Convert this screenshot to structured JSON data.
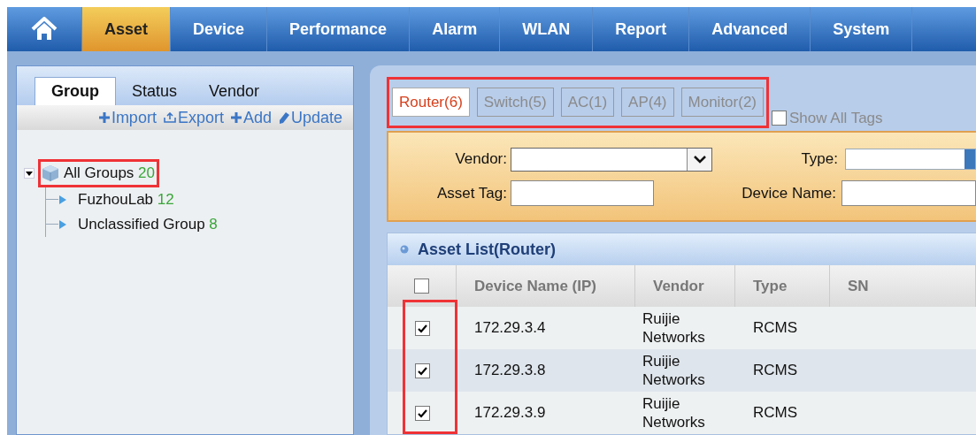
{
  "nav": {
    "items": [
      {
        "label": "Asset",
        "selected": true
      },
      {
        "label": "Device",
        "selected": false
      },
      {
        "label": "Performance",
        "selected": false
      },
      {
        "label": "Alarm",
        "selected": false
      },
      {
        "label": "WLAN",
        "selected": false
      },
      {
        "label": "Report",
        "selected": false
      },
      {
        "label": "Advanced",
        "selected": false
      },
      {
        "label": "System",
        "selected": false
      }
    ]
  },
  "sidebar": {
    "tabs": [
      {
        "label": "Group",
        "selected": true
      },
      {
        "label": "Status",
        "selected": false
      },
      {
        "label": "Vendor",
        "selected": false
      }
    ],
    "actions": [
      {
        "kind": "plus",
        "label": "Import"
      },
      {
        "kind": "export",
        "label": "Export"
      },
      {
        "kind": "plus",
        "label": "Add"
      },
      {
        "kind": "pencil",
        "label": "Update"
      }
    ],
    "tree": {
      "label": "All Groups",
      "count": "20",
      "expanded": true,
      "highlighted": true,
      "children": [
        {
          "label": "FuzhouLab",
          "count": "12"
        },
        {
          "label": "Unclassified Group",
          "count": "8"
        }
      ]
    }
  },
  "tag_tabs": [
    {
      "label": "Router(6)",
      "selected": true
    },
    {
      "label": "Switch(5)",
      "selected": false
    },
    {
      "label": "AC(1)",
      "selected": false
    },
    {
      "label": "AP(4)",
      "selected": false
    },
    {
      "label": "Monitor(2)",
      "selected": false
    }
  ],
  "show_all_tags": {
    "label": "Show All Tags",
    "checked": false
  },
  "filters": {
    "vendor_label": "Vendor:",
    "type_label": "Type:",
    "asset_tag_label": "Asset Tag:",
    "device_name_label": "Device Name:"
  },
  "table": {
    "title": "Asset List(Router)",
    "select_all_checked": false,
    "columns": [
      "Device Name (IP)",
      "Vendor",
      "Type",
      "SN"
    ],
    "rows": [
      {
        "checked": true,
        "cells": [
          "172.29.3.4",
          "Ruijie Networks",
          "RCMS"
        ]
      },
      {
        "checked": true,
        "cells": [
          "172.29.3.8",
          "Ruijie Networks",
          "RCMS"
        ]
      },
      {
        "checked": true,
        "cells": [
          "172.29.3.9",
          "Ruijie Networks",
          "RCMS"
        ]
      }
    ]
  }
}
